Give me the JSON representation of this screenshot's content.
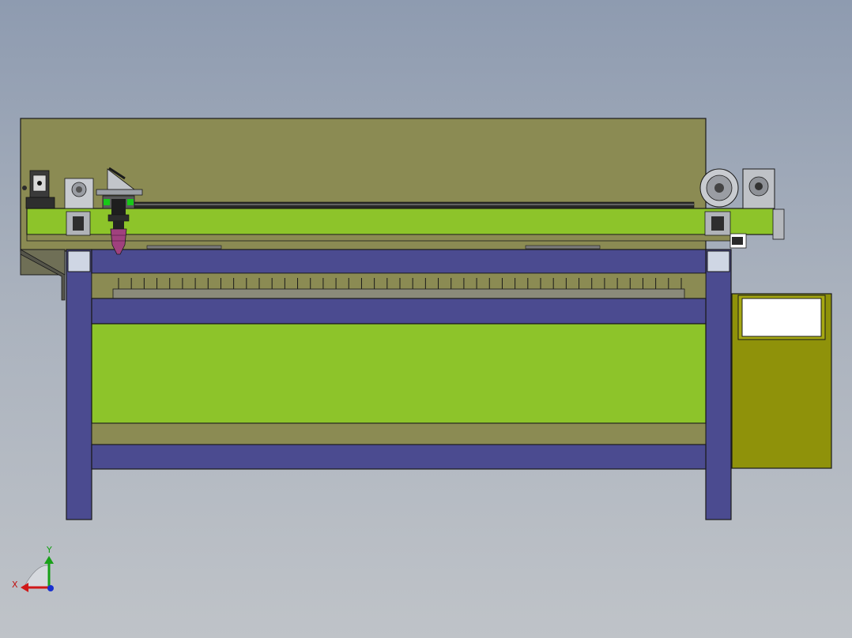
{
  "viewport": {
    "background_top": "#8e9bb0",
    "background_bottom": "#bfc3c8"
  },
  "model": {
    "colors": {
      "frame_blue": "#4b4b90",
      "bed_green": "#8dc42a",
      "gantry_olive": "#8b8b53",
      "cabinet_olive": "#8f920a",
      "cabinet_top": "#a6a812",
      "screen": "#ffffff",
      "laser_head": "#a0417e",
      "slat": "#7a7a5c",
      "outline": "#1a1a1a"
    },
    "bed_slat_count": 45
  },
  "triad": {
    "x_label": "X",
    "y_label": "Y",
    "x_color": "#d01818",
    "y_color": "#18a018",
    "z_color": "#1830d0"
  }
}
